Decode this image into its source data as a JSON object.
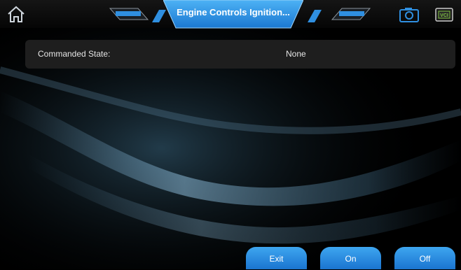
{
  "header": {
    "title": "Engine Controls Ignition...",
    "home_icon": "home-icon",
    "camera_icon": "camera-icon",
    "vci_icon": "vci-icon",
    "vci_label": "VCI",
    "accent": "#2b8fe0"
  },
  "main": {
    "row": {
      "label": "Commanded State:",
      "value": "None"
    }
  },
  "footer": {
    "buttons": [
      {
        "label": "Exit"
      },
      {
        "label": "On"
      },
      {
        "label": "Off"
      }
    ]
  }
}
